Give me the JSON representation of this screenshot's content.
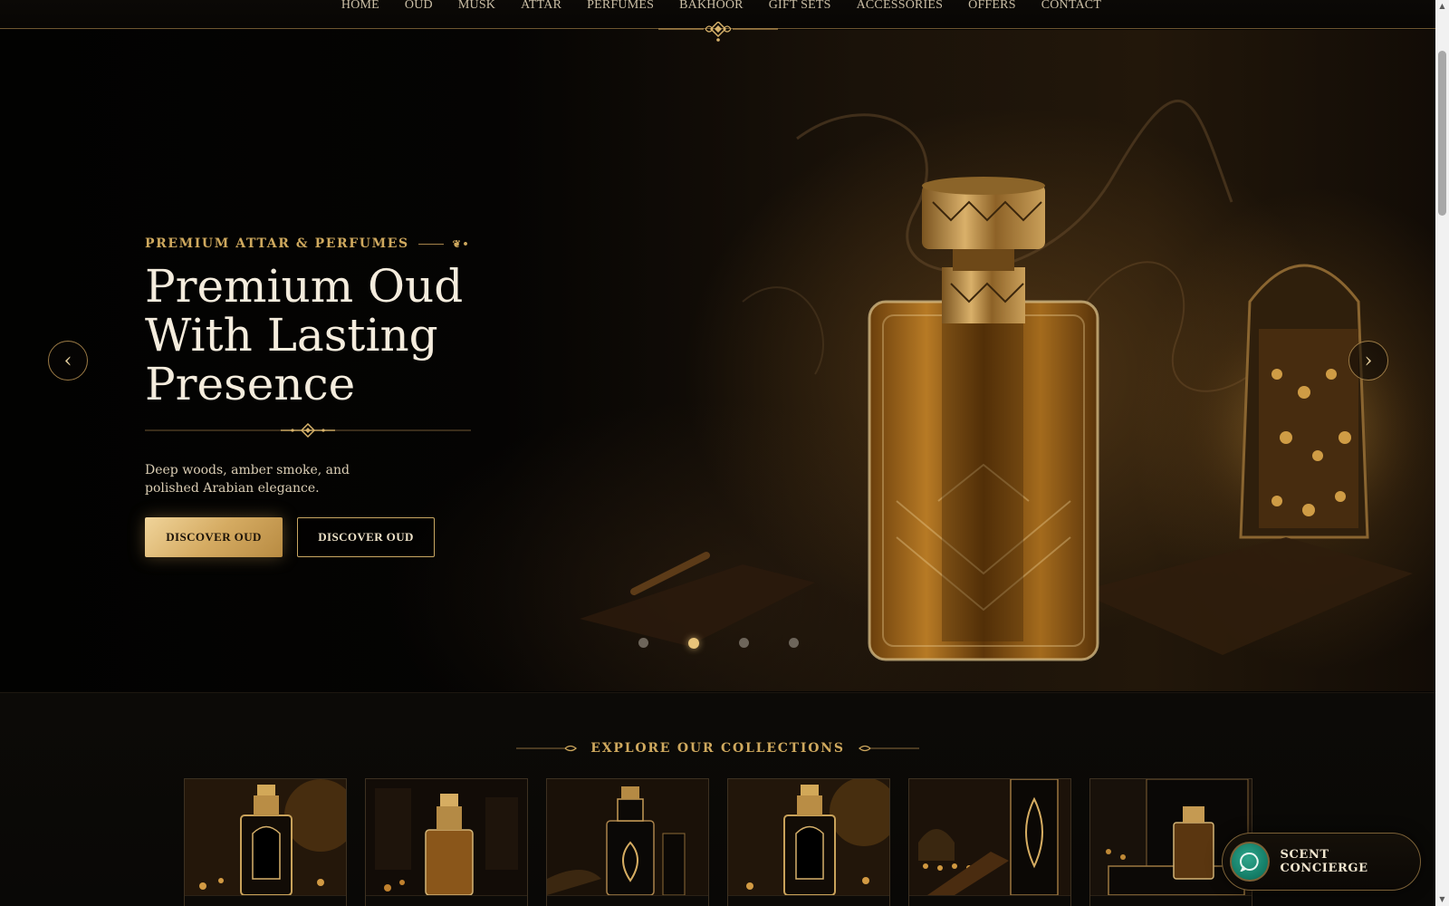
{
  "nav": {
    "items": [
      "HOME",
      "OUD",
      "MUSK",
      "ATTAR",
      "PERFUMES",
      "BAKHOOR",
      "GIFT SETS",
      "ACCESSORIES",
      "OFFERS",
      "CONTACT"
    ]
  },
  "hero": {
    "eyebrow": "PREMIUM ATTAR & PERFUMES",
    "title_line1": "Premium Oud",
    "title_line2": "With Lasting Presence",
    "description": "Deep woods, amber smoke, and polished Arabian elegance.",
    "primary_cta": "DISCOVER OUD",
    "secondary_cta": "DISCOVER OUD",
    "prev_arrow": "‹",
    "next_arrow": "›",
    "slides_total": 4,
    "active_slide": 2
  },
  "collections": {
    "title": "EXPLORE OUR COLLECTIONS",
    "cards": [
      {
        "image": "ornate-bottle-gold"
      },
      {
        "image": "amber-bottle-dark"
      },
      {
        "image": "black-bottle-gold-filigree"
      },
      {
        "image": "ornate-bottle-gold-2"
      },
      {
        "image": "bakhoor-box-mosque"
      },
      {
        "image": "gift-box-bottle"
      }
    ]
  },
  "concierge": {
    "label": "SCENT CONCIERGE",
    "icon": "chat-bubble-icon"
  },
  "colors": {
    "gold": "#cfa95e",
    "gold_light": "#e8c47a",
    "background": "#050403",
    "concierge_icon": "#1f8f76"
  }
}
